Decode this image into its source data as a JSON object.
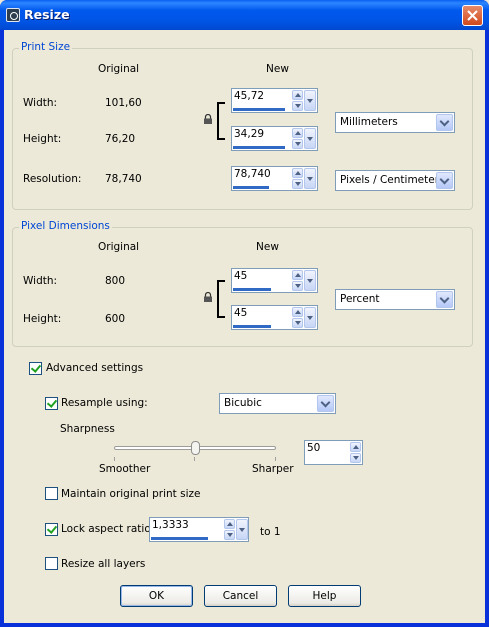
{
  "window": {
    "title": "Resize"
  },
  "print_size": {
    "group_title": "Print Size",
    "col_original": "Original",
    "col_new": "New",
    "width_label": "Width:",
    "width_original": "101,60",
    "width_new": "45,72",
    "height_label": "Height:",
    "height_original": "76,20",
    "height_new": "34,29",
    "units": "Millimeters",
    "resolution_label": "Resolution:",
    "resolution_original": "78,740",
    "resolution_new": "78,740",
    "resolution_units": "Pixels / Centimeter"
  },
  "pixel_dimensions": {
    "group_title": "Pixel Dimensions",
    "col_original": "Original",
    "col_new": "New",
    "width_label": "Width:",
    "width_original": "800",
    "width_new": "45",
    "height_label": "Height:",
    "height_original": "600",
    "height_new": "45",
    "units": "Percent"
  },
  "advanced": {
    "advanced_label": "Advanced settings",
    "advanced_checked": true,
    "resample_label": "Resample using:",
    "resample_checked": true,
    "resample_method": "Bicubic",
    "sharpness_label": "Sharpness",
    "sharpness_value": "50",
    "sharpness_level": 0.5,
    "smoother_label": "Smoother",
    "sharper_label": "Sharper",
    "maintain_label": "Maintain original print size",
    "maintain_checked": false,
    "lock_label": "Lock aspect ratio:",
    "lock_checked": true,
    "aspect_value": "1,3333",
    "aspect_suffix": "to 1",
    "resize_layers_label": "Resize all layers",
    "resize_layers_checked": false
  },
  "buttons": {
    "ok": "OK",
    "cancel": "Cancel",
    "help": "Help"
  }
}
